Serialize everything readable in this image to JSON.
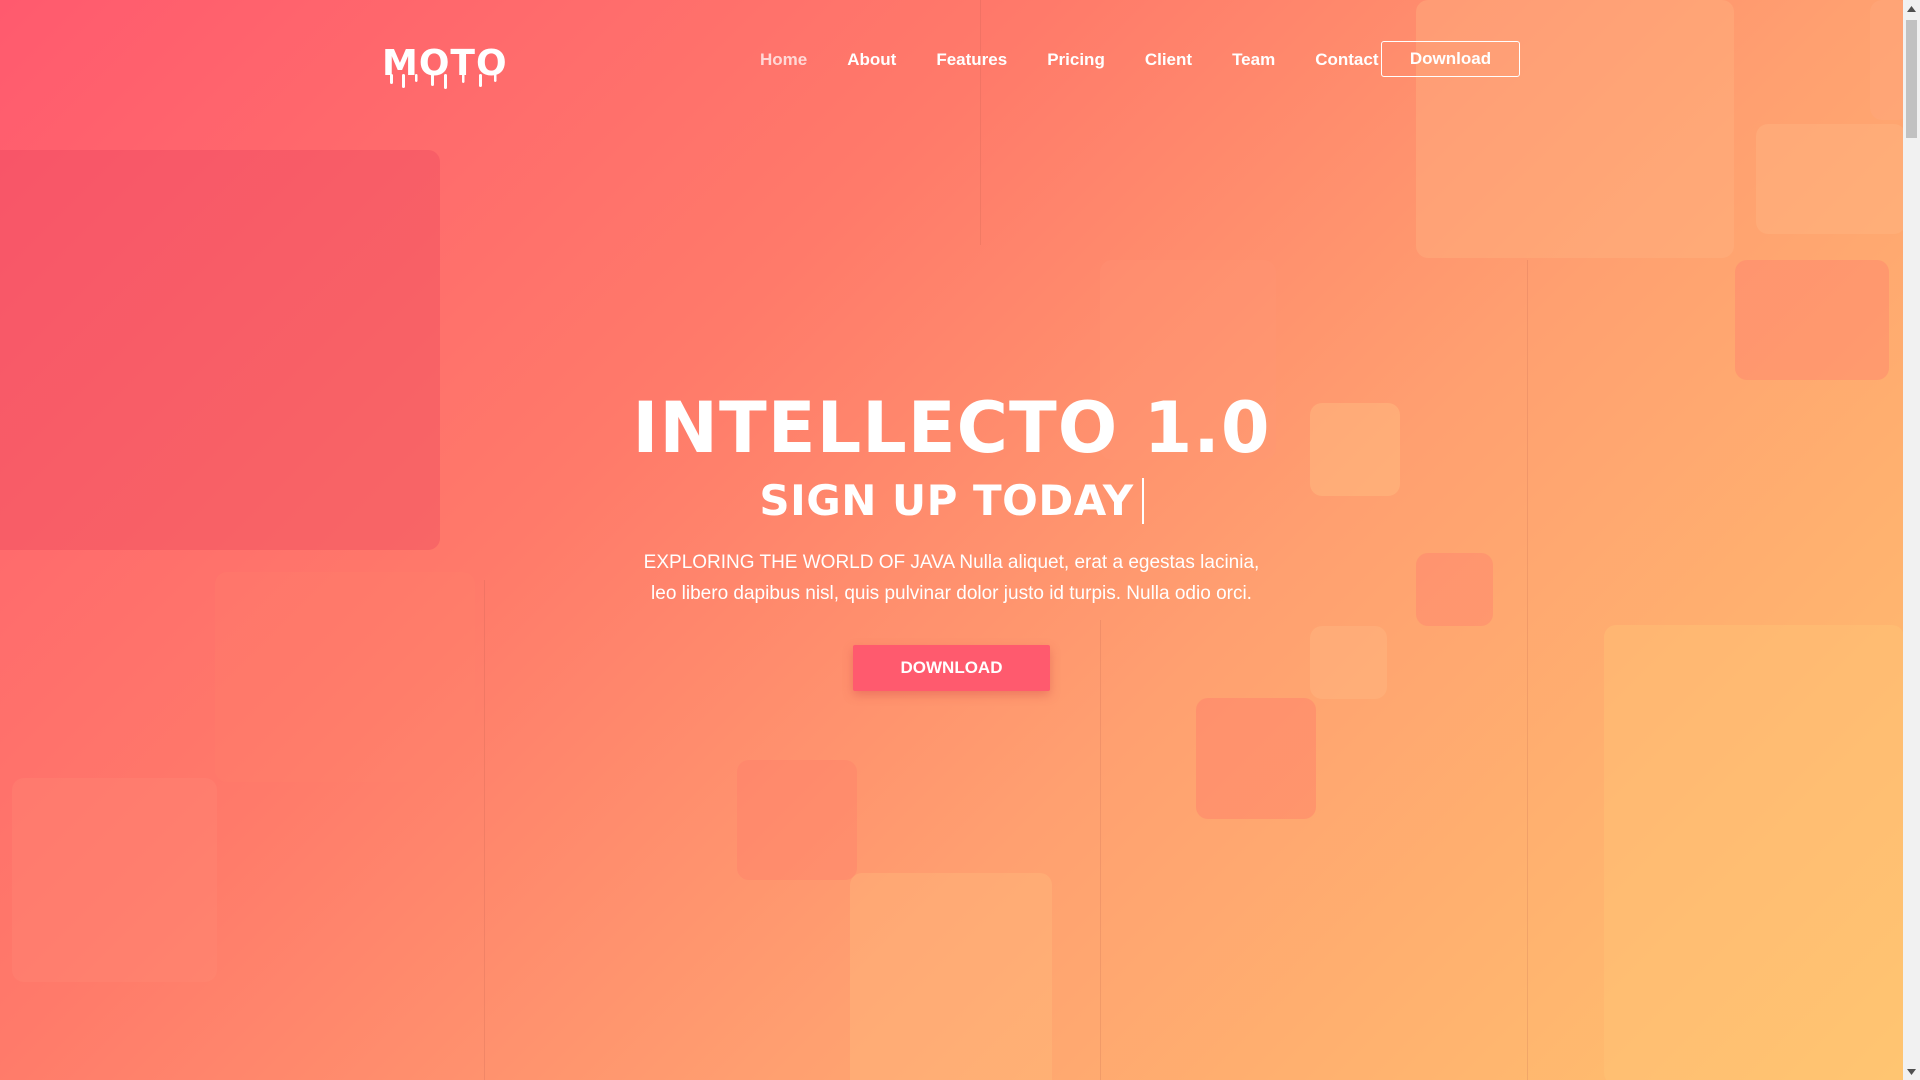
{
  "brand": {
    "logo_text": "MOTO"
  },
  "nav": {
    "items": [
      {
        "label": "Home",
        "active": true
      },
      {
        "label": "About",
        "active": false
      },
      {
        "label": "Features",
        "active": false
      },
      {
        "label": "Pricing",
        "active": false
      },
      {
        "label": "Client",
        "active": false
      },
      {
        "label": "Team",
        "active": false
      },
      {
        "label": "Contact",
        "active": false
      }
    ],
    "download_label": "Download"
  },
  "hero": {
    "title": "INTELLECTO 1.0",
    "subtitle": "SIGN UP TODAY",
    "description": "EXPLORING THE WORLD OF JAVA Nulla aliquet, erat a egestas lacinia, leo libero dapibus nisl, quis pulvinar dolor justo id turpis. Nulla odio orci.",
    "button_label": "DOWNLOAD"
  },
  "theme": {
    "gradient_start": "#ff5a6e",
    "gradient_end": "#ffc46e",
    "accent": "#ff5a6e",
    "text": "#ffffff"
  },
  "icons": {
    "scroll_up": "triangle-up-icon",
    "scroll_down": "triangle-down-icon"
  }
}
